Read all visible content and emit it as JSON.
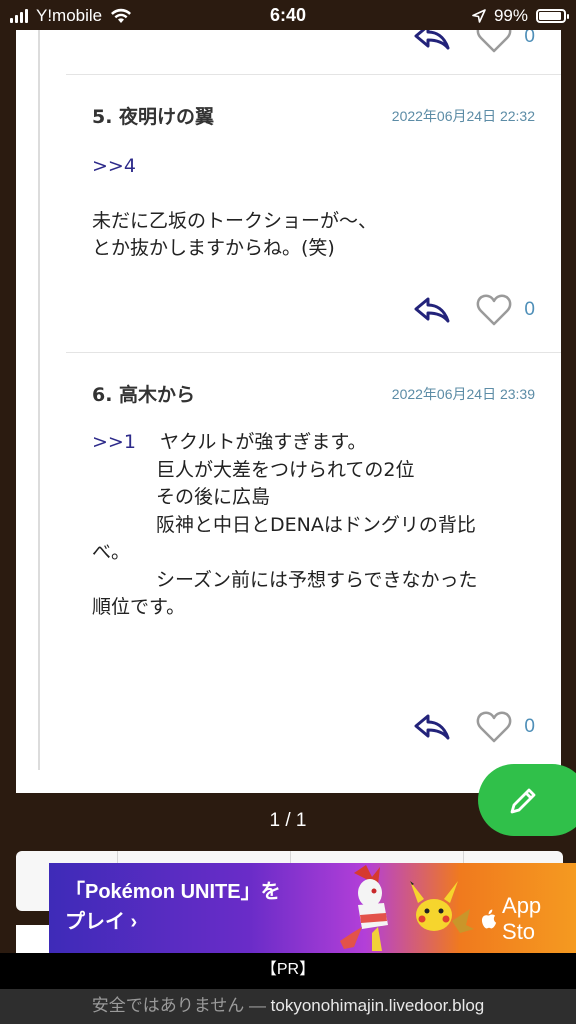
{
  "status_bar": {
    "carrier": "Y!mobile",
    "time": "6:40",
    "battery_percent": "99%",
    "battery_level": 0.99
  },
  "top_actions": {
    "like_count": "0"
  },
  "comments": [
    {
      "number_name": "5.  夜明けの翼",
      "date": "2022年06月24日 22:32",
      "anchor": ">>4",
      "lines": [
        "未だに乙坂のトークショーが〜、",
        "とか抜かしますからね。(笑)"
      ],
      "like_count": "0"
    },
    {
      "number_name": "6.  高木から",
      "date": "2022年06月24日 23:39",
      "anchor": ">>1",
      "first_line": "ヤクルトが強すぎます。",
      "lines": [
        "巨人が大差をつけられての2位",
        "その後に広島",
        "阪神と中日とDENAはドングリの背比",
        "べ。",
        "シーズン前には予想すらできなかった",
        "順位です。"
      ],
      "like_count": "0"
    }
  ],
  "pagination": {
    "label": "1 / 1"
  },
  "ad": {
    "line1": "「Pokémon UNITE」を",
    "line2": "プレイ ›",
    "store_label": "App Sto"
  },
  "pr_label": "【PR】",
  "url_bar": {
    "warning": "安全ではありません — ",
    "domain": "tokyonohimajin.livedoor.blog"
  },
  "colors": {
    "background": "#2b1b10",
    "accent_green": "#30c04a",
    "anchor_link": "#2d2a8a",
    "date_text": "#5c8ca6",
    "icon_navy": "#23237a"
  }
}
